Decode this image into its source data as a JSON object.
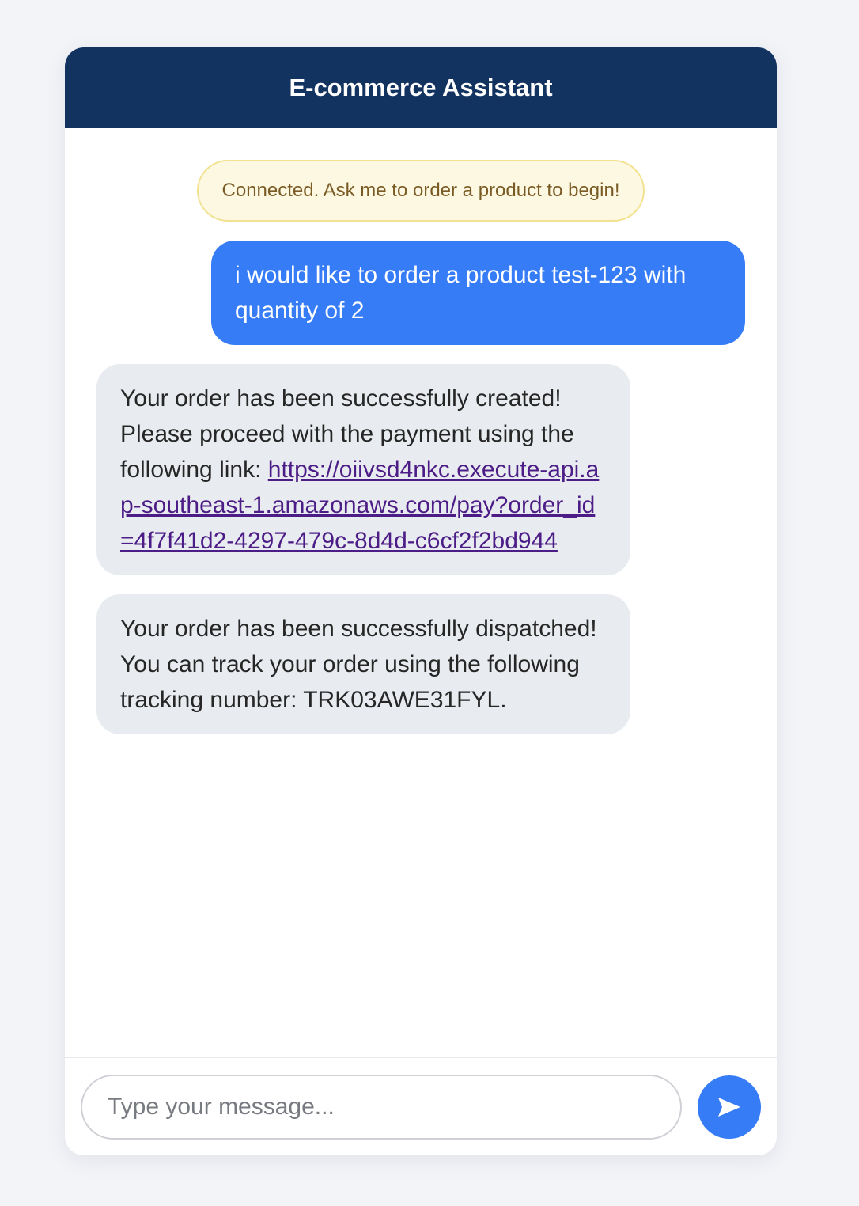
{
  "header": {
    "title": "E-commerce Assistant"
  },
  "system_notice": "Connected. Ask me to order a product to begin!",
  "messages": {
    "user_1": "i would like to order a product test-123 with quantity of 2",
    "bot_1": {
      "text": "Your order has been successfully created! Please proceed with the payment using the following link: ",
      "link": "https://oiivsd4nkc.execute-api.ap-southeast-1.amazonaws.com/pay?order_id=4f7f41d2-4297-479c-8d4d-c6cf2f2bd944"
    },
    "bot_2": "Your order has been successfully dispatched! You can track your order using the following tracking number: TRK03AWE31FYL."
  },
  "input": {
    "placeholder": "Type your message...",
    "value": ""
  },
  "send_button": {
    "icon": "send-arrow-icon"
  },
  "colors": {
    "header_bg": "#12325f",
    "user_bubble": "#367cf6",
    "bot_bubble": "#e8ebef",
    "notice_bg": "#fdf8e1",
    "notice_border": "#f2e18f",
    "link": "#4d1d87"
  }
}
